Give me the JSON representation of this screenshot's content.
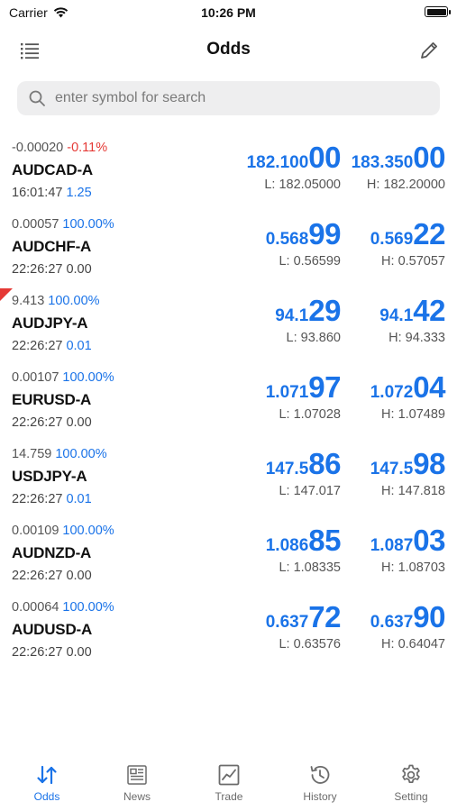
{
  "status": {
    "carrier": "Carrier",
    "time": "10:26 PM"
  },
  "nav": {
    "title": "Odds"
  },
  "search": {
    "placeholder": "enter symbol for search"
  },
  "colors": {
    "accent": "#1a73e8",
    "negative": "#e53935",
    "neutral": "#555555"
  },
  "rows": [
    {
      "change": "-0.00020",
      "pct": "-0.11%",
      "pct_color": "#e53935",
      "symbol": "AUDCAD-A",
      "time": "16:01:47",
      "spread": "1.25",
      "spread_color": "#1a73e8",
      "bid_small": "182.100",
      "bid_big": "00",
      "ask_small": "183.350",
      "ask_big": "00",
      "low": "L: 182.05000",
      "high": "H: 182.20000",
      "flag": false
    },
    {
      "change": "0.00057",
      "pct": "100.00%",
      "pct_color": "#1a73e8",
      "symbol": "AUDCHF-A",
      "time": "22:26:27",
      "spread": "0.00",
      "spread_color": "#444444",
      "bid_small": "0.568",
      "bid_big": "99",
      "ask_small": "0.569",
      "ask_big": "22",
      "low": "L: 0.56599",
      "high": "H: 0.57057",
      "flag": false
    },
    {
      "change": "9.413",
      "pct": "100.00%",
      "pct_color": "#1a73e8",
      "symbol": "AUDJPY-A",
      "time": "22:26:27",
      "spread": "0.01",
      "spread_color": "#1a73e8",
      "bid_small": "94.1",
      "bid_big": "29",
      "ask_small": "94.1",
      "ask_big": "42",
      "low": "L: 93.860",
      "high": "H: 94.333",
      "flag": true
    },
    {
      "change": "0.00107",
      "pct": "100.00%",
      "pct_color": "#1a73e8",
      "symbol": "EURUSD-A",
      "time": "22:26:27",
      "spread": "0.00",
      "spread_color": "#444444",
      "bid_small": "1.071",
      "bid_big": "97",
      "ask_small": "1.072",
      "ask_big": "04",
      "low": "L: 1.07028",
      "high": "H: 1.07489",
      "flag": false
    },
    {
      "change": "14.759",
      "pct": "100.00%",
      "pct_color": "#1a73e8",
      "symbol": "USDJPY-A",
      "time": "22:26:27",
      "spread": "0.01",
      "spread_color": "#1a73e8",
      "bid_small": "147.5",
      "bid_big": "86",
      "ask_small": "147.5",
      "ask_big": "98",
      "low": "L: 147.017",
      "high": "H: 147.818",
      "flag": false
    },
    {
      "change": "0.00109",
      "pct": "100.00%",
      "pct_color": "#1a73e8",
      "symbol": "AUDNZD-A",
      "time": "22:26:27",
      "spread": "0.00",
      "spread_color": "#444444",
      "bid_small": "1.086",
      "bid_big": "85",
      "ask_small": "1.087",
      "ask_big": "03",
      "low": "L: 1.08335",
      "high": "H: 1.08703",
      "flag": false
    },
    {
      "change": "0.00064",
      "pct": "100.00%",
      "pct_color": "#1a73e8",
      "symbol": "AUDUSD-A",
      "time": "22:26:27",
      "spread": "0.00",
      "spread_color": "#444444",
      "bid_small": "0.637",
      "bid_big": "72",
      "ask_small": "0.637",
      "ask_big": "90",
      "low": "L: 0.63576",
      "high": "H: 0.64047",
      "flag": false
    }
  ],
  "tabs": [
    {
      "label": "Odds",
      "icon": "sort-arrows-icon",
      "active": true
    },
    {
      "label": "News",
      "icon": "newspaper-icon",
      "active": false
    },
    {
      "label": "Trade",
      "icon": "chart-icon",
      "active": false
    },
    {
      "label": "History",
      "icon": "history-clock-icon",
      "active": false
    },
    {
      "label": "Setting",
      "icon": "gear-icon",
      "active": false
    }
  ]
}
